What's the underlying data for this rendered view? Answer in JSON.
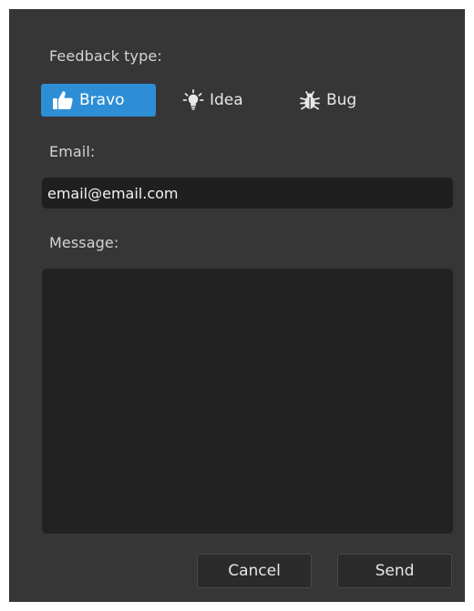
{
  "dialog": {
    "feedback_type_label": "Feedback type:",
    "types": [
      {
        "label": "Bravo",
        "icon": "thumbs-up-icon",
        "selected": true
      },
      {
        "label": "Idea",
        "icon": "lightbulb-icon",
        "selected": false
      },
      {
        "label": "Bug",
        "icon": "bug-icon",
        "selected": false
      }
    ],
    "email_label": "Email:",
    "email_value": "email@email.com",
    "message_label": "Message:",
    "message_value": "",
    "cancel_label": "Cancel",
    "send_label": "Send"
  },
  "colors": {
    "background": "#363636",
    "accent": "#2d8ed6",
    "field": "#1f1f1f"
  }
}
